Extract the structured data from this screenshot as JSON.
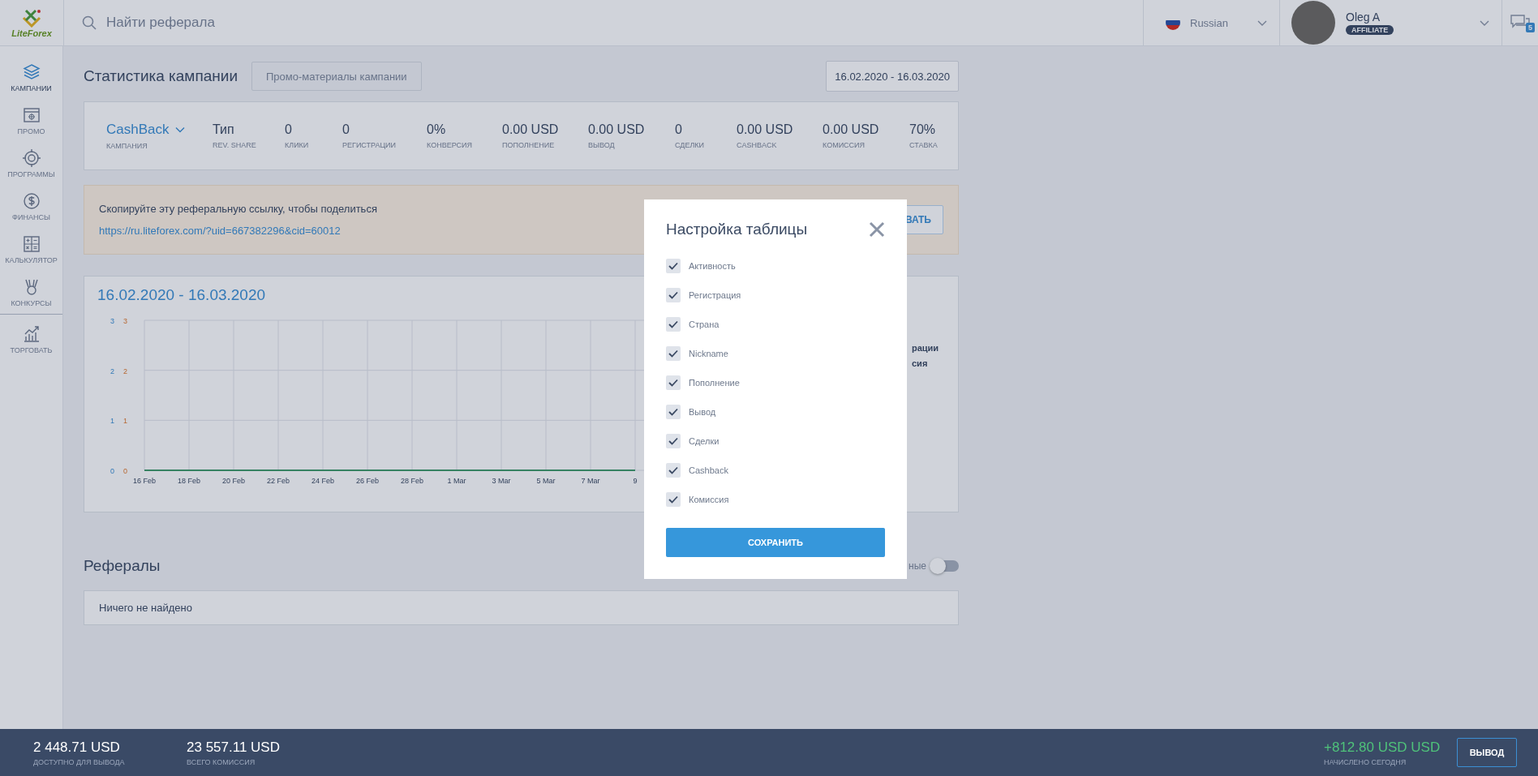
{
  "header": {
    "logo": "LiteForex",
    "search": {
      "placeholder": "Найти реферала"
    },
    "language": "Russian",
    "user": {
      "name": "Oleg A",
      "role": "AFFILIATE"
    },
    "messages_badge": "5"
  },
  "sidebar": {
    "items": [
      {
        "label": "КАМПАНИИ",
        "selected": true
      },
      {
        "label": "ПРОМО",
        "selected": false
      },
      {
        "label": "ПРОГРАММЫ",
        "selected": false
      },
      {
        "label": "ФИНАНСЫ",
        "selected": false
      },
      {
        "label": "КАЛЬКУЛЯТОР",
        "selected": false
      },
      {
        "label": "КОНКУРСЫ",
        "selected": false
      }
    ],
    "extra_items": [
      {
        "label": "ТОРГОВАТЬ",
        "selected": false
      }
    ]
  },
  "campaign": {
    "title": "Статистика кампании",
    "promo_button": "Промо-материалы кампании",
    "date_range": "16.02.2020 - 16.03.2020",
    "stats": [
      {
        "kind": "dropdown",
        "value": "CashBack",
        "label": "КАМПАНИЯ"
      },
      {
        "kind": "stat",
        "value": "Тип",
        "label": "REV. SHARE"
      },
      {
        "kind": "stat",
        "value": "0",
        "label": "КЛИКИ"
      },
      {
        "kind": "stat",
        "value": "0",
        "label": "РЕГИСТРАЦИИ"
      },
      {
        "kind": "stat",
        "value": "0%",
        "label": "КОНВЕРСИЯ"
      },
      {
        "kind": "stat",
        "value": "0.00 USD",
        "label": "ПОПОЛНЕНИЕ"
      },
      {
        "kind": "stat",
        "value": "0.00 USD",
        "label": "ВЫВОД"
      },
      {
        "kind": "stat",
        "value": "0",
        "label": "СДЕЛКИ"
      },
      {
        "kind": "stat",
        "value": "0.00 USD",
        "label": "CASHBACK"
      },
      {
        "kind": "stat",
        "value": "0.00 USD",
        "label": "КОМИССИЯ"
      },
      {
        "kind": "stat",
        "value": "70%",
        "label": "СТАВКА"
      }
    ]
  },
  "share": {
    "text": "Скопируйте эту реферальную ссылку, чтобы поделиться",
    "link": "https://ru.liteforex.com/?uid=667382296&cid=60012",
    "button": "ВАТЬ"
  },
  "chart": {
    "title": "16.02.2020 - 16.03.2020",
    "legend": [
      "рации",
      "сия"
    ],
    "chart_data": {
      "type": "line",
      "categories": [
        "16 Feb",
        "18 Feb",
        "20 Feb",
        "22 Feb",
        "24 Feb",
        "26 Feb",
        "28 Feb",
        "1 Mar",
        "3 Mar",
        "5 Mar",
        "7 Mar",
        "9"
      ],
      "series": [
        {
          "color": "#3f9a6a",
          "values": [
            0,
            0,
            0,
            0,
            0,
            0,
            0,
            0,
            0,
            0,
            0,
            0
          ]
        }
      ],
      "yticks": [
        0,
        1,
        2,
        3
      ],
      "ylim": [
        0,
        3
      ],
      "grid": true
    },
    "secondary_axis_ticks": [
      "3",
      "2",
      "1",
      "0"
    ]
  },
  "referrals": {
    "title": "Рефералы",
    "toggle": {
      "label": "ные",
      "on": false
    },
    "empty": "Ничего не найдено"
  },
  "modal": {
    "title": "Настройка таблицы",
    "options": [
      {
        "label": "Активность",
        "checked": true
      },
      {
        "label": "Регистрация",
        "checked": true
      },
      {
        "label": "Страна",
        "checked": true
      },
      {
        "label": "Nickname",
        "checked": true
      },
      {
        "label": "Пополнение",
        "checked": true
      },
      {
        "label": "Вывод",
        "checked": true
      },
      {
        "label": "Сделки",
        "checked": true
      },
      {
        "label": "Cashback",
        "checked": true
      },
      {
        "label": "Комиссия",
        "checked": true
      }
    ],
    "save": "СОХРАНИТЬ"
  },
  "footer": {
    "balances": [
      {
        "value": "2 448.71 USD",
        "label": "ДОСТУПНО ДЛЯ ВЫВОДА"
      },
      {
        "value": "23 557.11 USD",
        "label": "ВСЕГО КОМИССИЯ"
      }
    ],
    "today": {
      "value": "+812.80 USD USD",
      "label": "НАЧИСЛЕНО СЕГОДНЯ"
    },
    "withdraw": "ВЫВОД"
  }
}
